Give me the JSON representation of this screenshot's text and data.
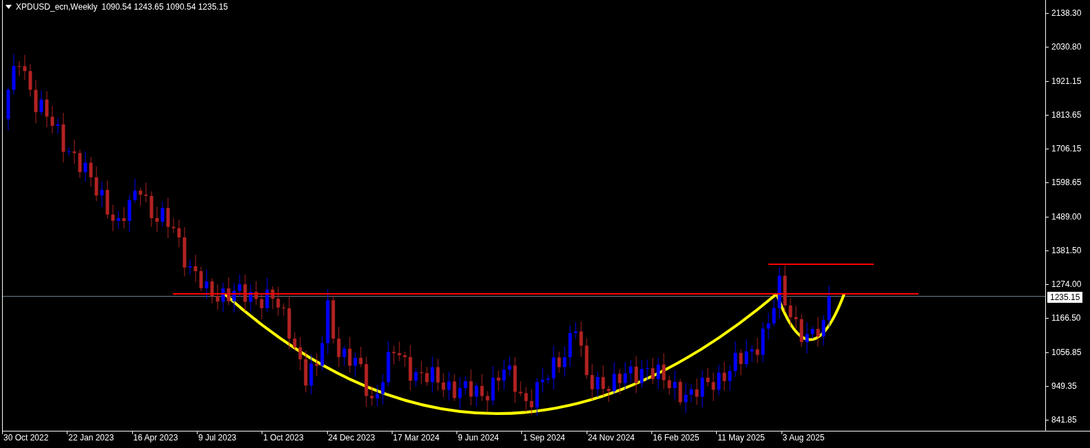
{
  "chart": {
    "header": {
      "caption": "XPDUSD_ecn,Weekly",
      "ohlc": "1090.54 1243.65 1090.54 1235.15"
    },
    "price_axis": [
      "2138.30",
      "2030.80",
      "1921.15",
      "1813.65",
      "1706.15",
      "1598.65",
      "1489.00",
      "1381.50",
      "1274.00",
      "1166.50",
      "1056.85",
      "949.35",
      "841.85"
    ],
    "current_price": "1235.15",
    "time_axis": [
      "30 Oct 2022",
      "22 Jan 2023",
      "16 Apr 2023",
      "9 Jul 2023",
      "1 Oct 2023",
      "24 Dec 2023",
      "17 Mar 2024",
      "9 Jun 2024",
      "1 Sep 2024",
      "24 Nov 2024",
      "16 Feb 2025",
      "11 May 2025",
      "3 Aug 2025"
    ]
  }
}
